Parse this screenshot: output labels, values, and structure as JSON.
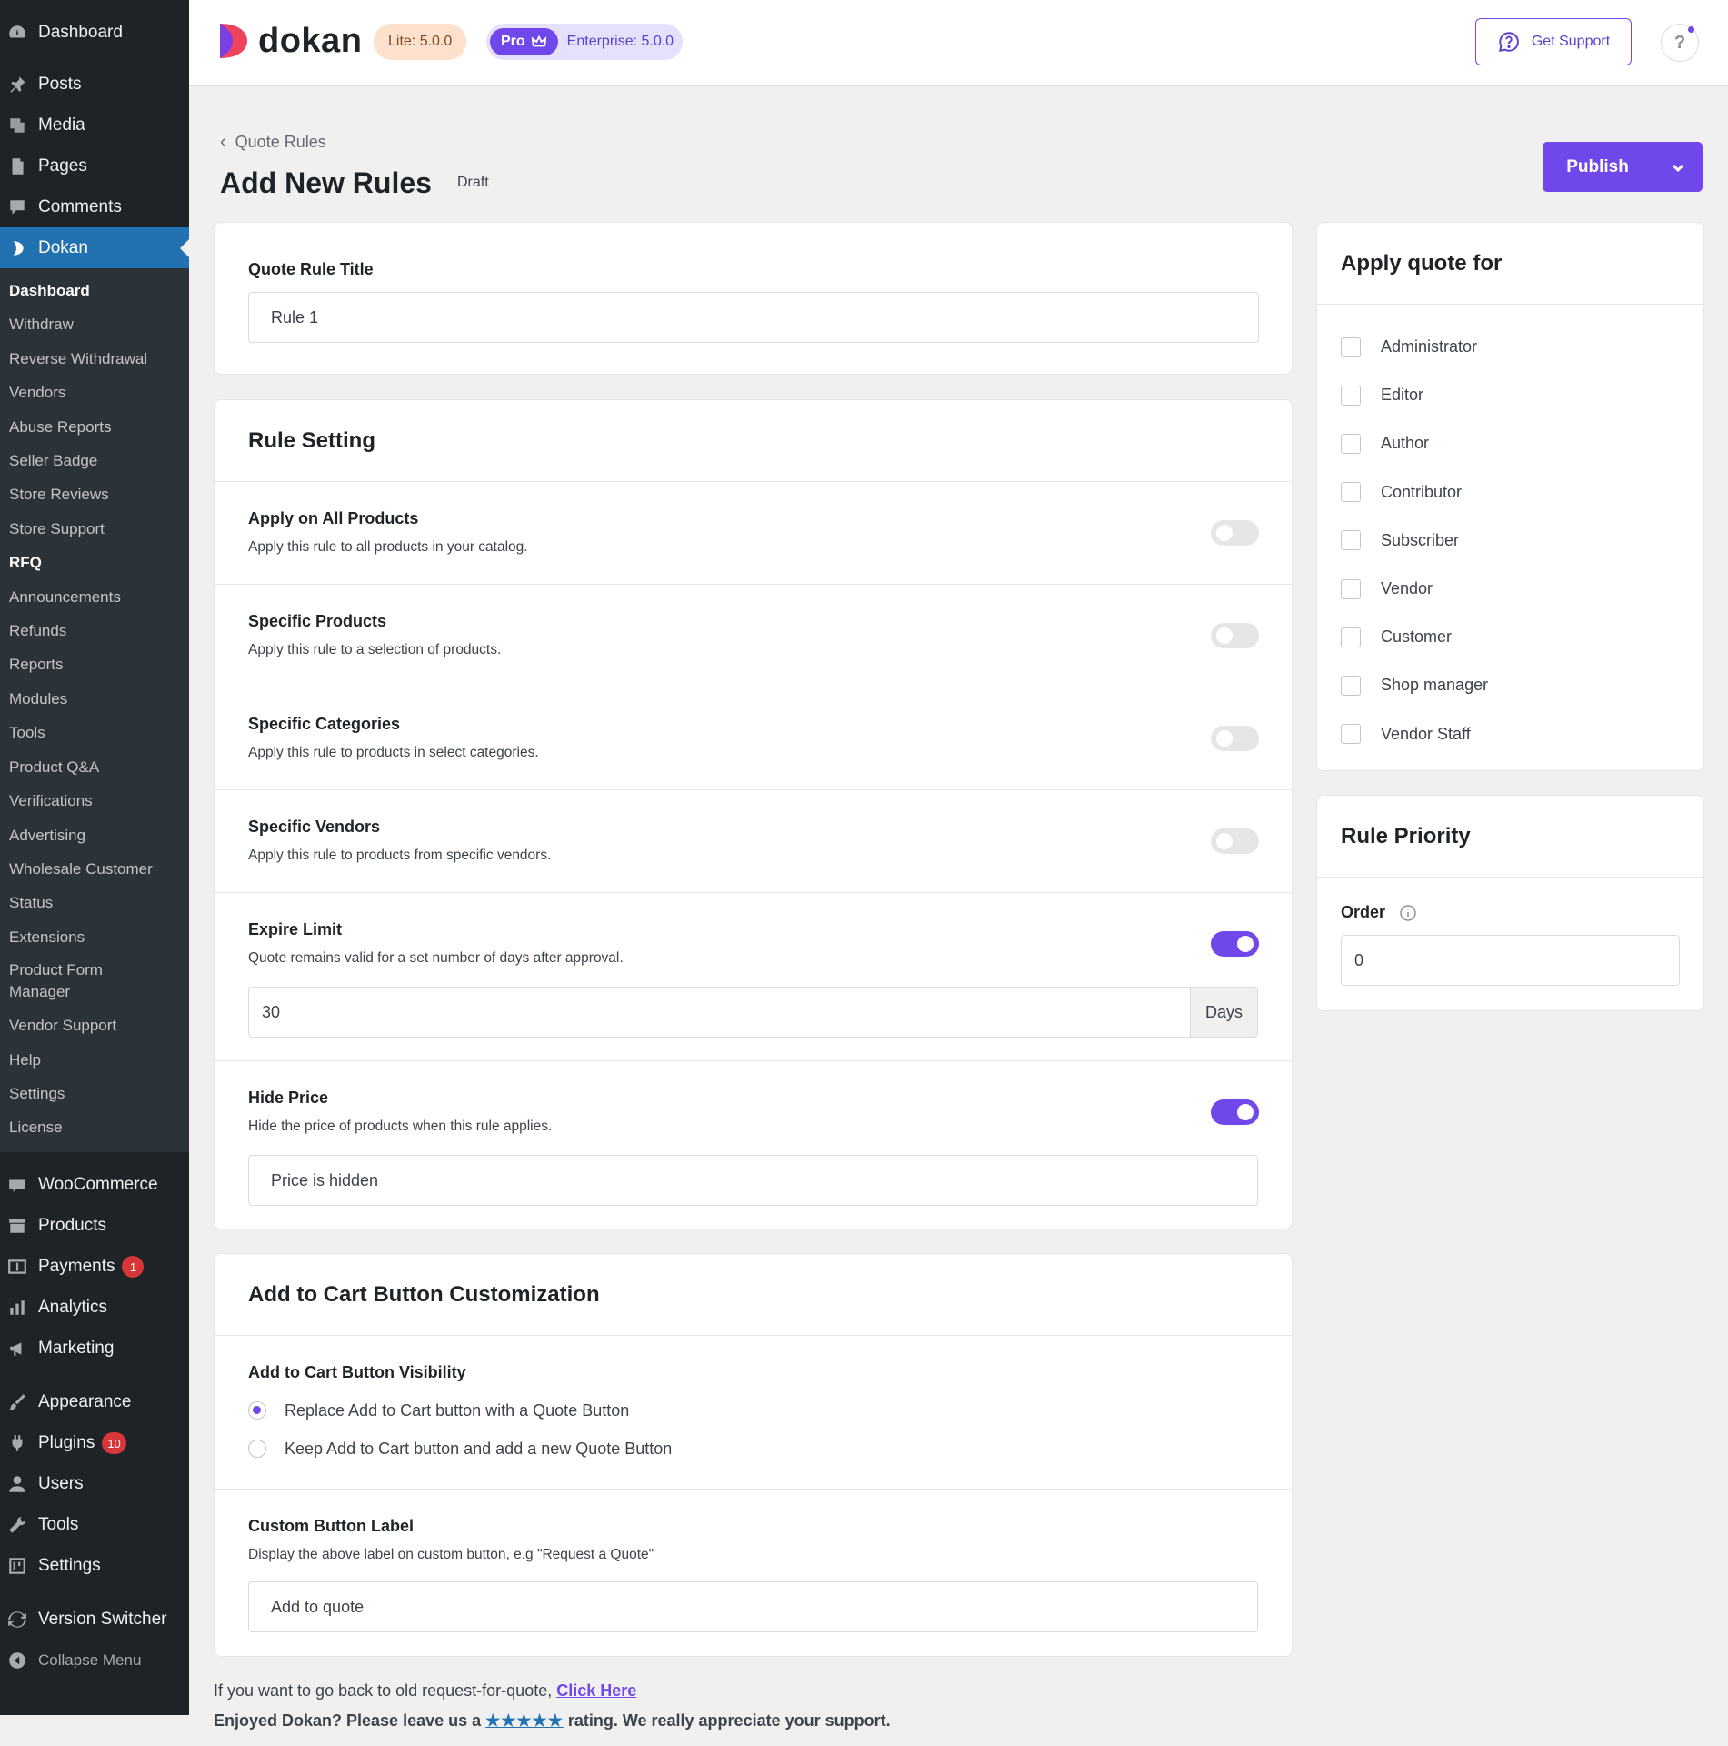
{
  "sidebar": {
    "top": [
      {
        "label": "Dashboard",
        "icon": "dashboard-icon"
      },
      {
        "label": "Posts",
        "icon": "pushpin-icon"
      },
      {
        "label": "Media",
        "icon": "media-icon"
      },
      {
        "label": "Pages",
        "icon": "pages-icon"
      },
      {
        "label": "Comments",
        "icon": "comment-icon"
      },
      {
        "label": "Dokan",
        "icon": "dokan-icon"
      }
    ],
    "dokan_submenu": [
      "Dashboard",
      "Withdraw",
      "Reverse Withdrawal",
      "Vendors",
      "Abuse Reports",
      "Seller Badge",
      "Store Reviews",
      "Store Support",
      "RFQ",
      "Announcements",
      "Refunds",
      "Reports",
      "Modules",
      "Tools",
      "Product Q&A",
      "Verifications",
      "Advertising",
      "Wholesale Customer",
      "Status",
      "Extensions",
      "Product Form Manager",
      "Vendor Support",
      "Help",
      "Settings",
      "License"
    ],
    "woo": [
      {
        "label": "WooCommerce",
        "icon": "woocommerce-icon"
      },
      {
        "label": "Products",
        "icon": "archive-icon"
      },
      {
        "label": "Payments",
        "icon": "payments-icon",
        "badge": "1"
      },
      {
        "label": "Analytics",
        "icon": "chart-bar-icon"
      },
      {
        "label": "Marketing",
        "icon": "megaphone-icon"
      }
    ],
    "bottom": [
      {
        "label": "Appearance",
        "icon": "paintbrush-icon"
      },
      {
        "label": "Plugins",
        "icon": "plugin-icon",
        "badge": "10"
      },
      {
        "label": "Users",
        "icon": "users-icon"
      },
      {
        "label": "Tools",
        "icon": "wrench-icon"
      },
      {
        "label": "Settings",
        "icon": "settings-icon"
      }
    ],
    "version_switcher": "Version Switcher",
    "collapse": "Collapse Menu"
  },
  "header": {
    "brand": "dokan",
    "lite": "Lite: 5.0.0",
    "pro": "Pro",
    "enterprise": "Enterprise: 5.0.0",
    "support": "Get Support",
    "help": "?"
  },
  "page": {
    "breadcrumb": "Quote Rules",
    "title": "Add New Rules",
    "status": "Draft",
    "publish": "Publish"
  },
  "title_card": {
    "label": "Quote Rule Title",
    "value": "Rule 1"
  },
  "rule_setting": {
    "heading": "Rule Setting",
    "rows": [
      {
        "title": "Apply on All Products",
        "desc": "Apply this rule to all products in your catalog.",
        "on": false
      },
      {
        "title": "Specific Products",
        "desc": "Apply this rule to a selection of products.",
        "on": false
      },
      {
        "title": "Specific Categories",
        "desc": "Apply this rule to products in select categories.",
        "on": false
      },
      {
        "title": "Specific Vendors",
        "desc": "Apply this rule to products from specific vendors.",
        "on": false
      }
    ],
    "expire": {
      "title": "Expire Limit",
      "desc": "Quote remains valid for a set number of days after approval.",
      "on": true,
      "value": "30",
      "suffix": "Days"
    },
    "hide_price": {
      "title": "Hide Price",
      "desc": "Hide the price of products when this rule applies.",
      "on": true,
      "value": "Price is hidden"
    }
  },
  "cart_card": {
    "heading": "Add to Cart Button Customization",
    "visibility_label": "Add to Cart Button Visibility",
    "options": [
      {
        "label": "Replace Add to Cart button with a Quote Button",
        "checked": true
      },
      {
        "label": "Keep Add to Cart button and add a new Quote Button",
        "checked": false
      }
    ],
    "custom_label_title": "Custom Button Label",
    "custom_label_desc": "Display the above label on custom button, e.g \"Request a Quote\"",
    "custom_label_value": "Add to quote"
  },
  "apply_card": {
    "heading": "Apply quote for",
    "roles": [
      "Administrator",
      "Editor",
      "Author",
      "Contributor",
      "Subscriber",
      "Vendor",
      "Customer",
      "Shop manager",
      "Vendor Staff"
    ]
  },
  "priority_card": {
    "heading": "Rule Priority",
    "order_label": "Order",
    "order_value": "0"
  },
  "footer": {
    "line1_prefix": "If you want to go back to old request-for-quote, ",
    "line1_link": "Click Here",
    "line2_prefix": "Enjoyed Dokan? Please leave us a ",
    "stars": "★★★★★",
    "line2_suffix": " rating. We really appreciate your support."
  },
  "colors": {
    "accent": "#7047eb",
    "admin_bg": "#1d2327",
    "wp_blue": "#2271b1",
    "badge_red": "#d63638"
  }
}
